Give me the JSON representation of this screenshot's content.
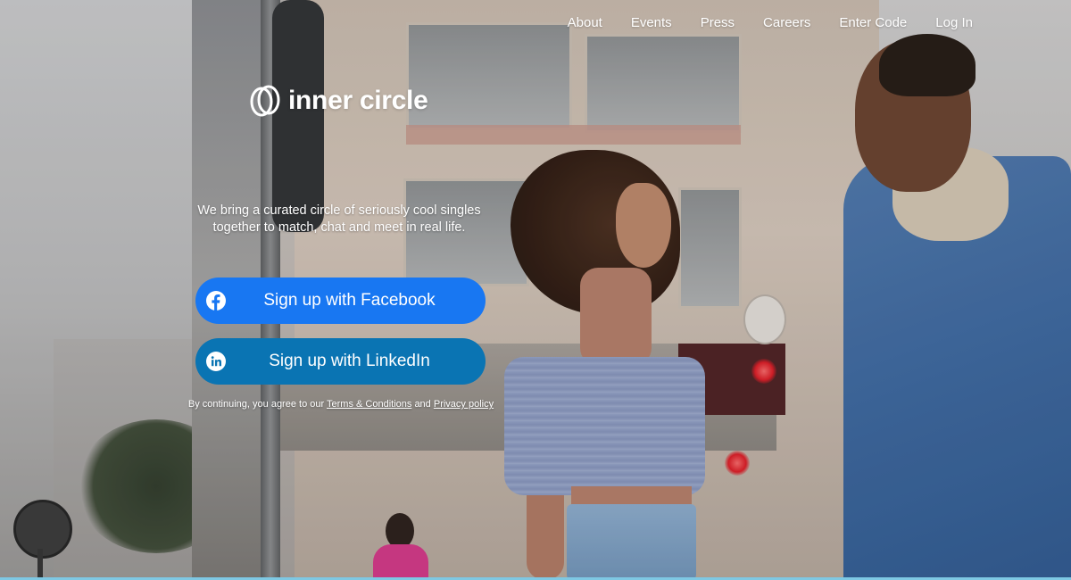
{
  "nav": {
    "items": [
      {
        "label": "About"
      },
      {
        "label": "Events"
      },
      {
        "label": "Press"
      },
      {
        "label": "Careers"
      },
      {
        "label": "Enter Code"
      },
      {
        "label": "Log In"
      }
    ]
  },
  "brand": {
    "name": "inner circle",
    "logo_icon": "interlocking-circles-icon"
  },
  "hero": {
    "tagline_line1": "We bring a curated circle of seriously cool singles",
    "tagline_line2": "together to match, chat and meet in real life."
  },
  "buttons": {
    "facebook": {
      "label": "Sign up with Facebook",
      "icon": "facebook-icon",
      "color": "#1877f2"
    },
    "linkedin": {
      "label": "Sign up with LinkedIn",
      "icon": "linkedin-icon",
      "color": "#0a74b3"
    }
  },
  "legal": {
    "prefix": "By continuing, you agree to our",
    "terms_label": "Terms & Conditions",
    "and_label": "and",
    "privacy_label": "Privacy policy"
  },
  "colors": {
    "text": "#ffffff",
    "accent_line": "#7ec8e3"
  }
}
